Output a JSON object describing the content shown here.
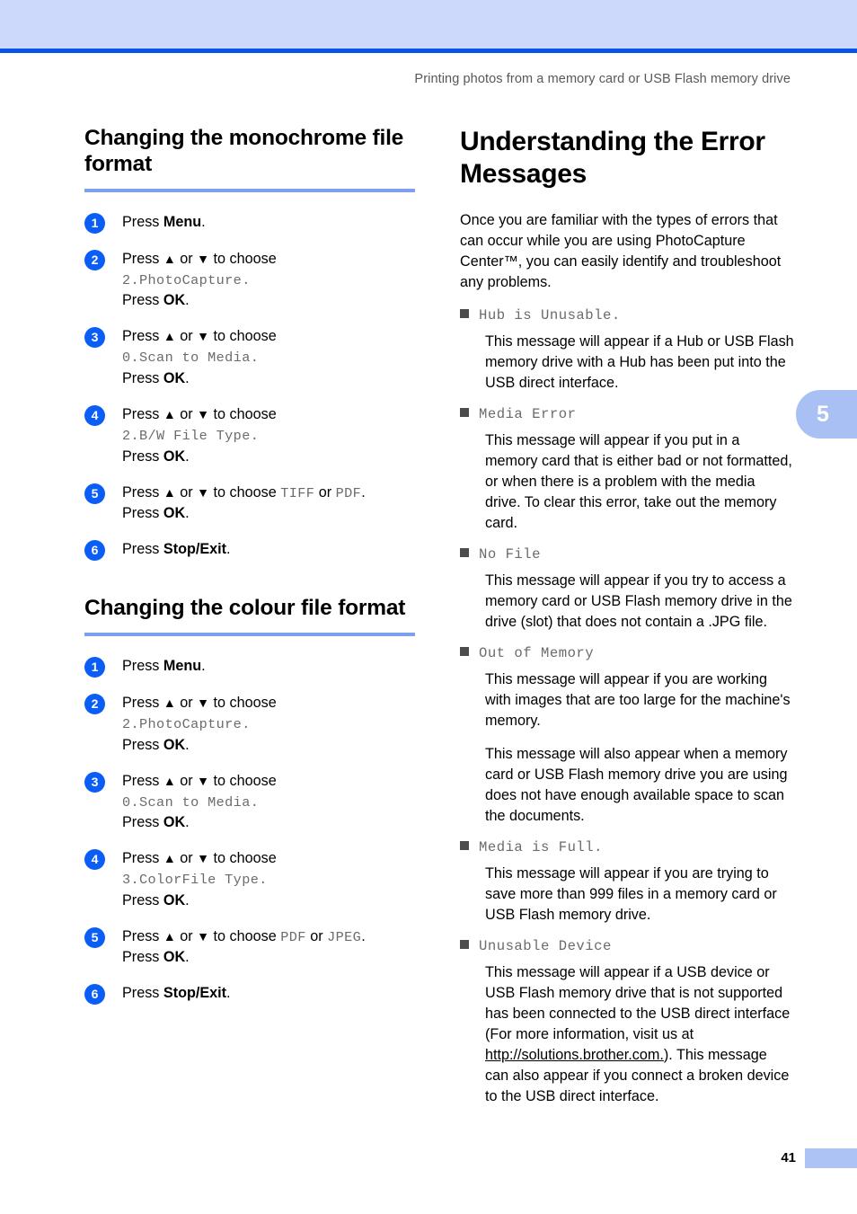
{
  "colors": {
    "band": "#ccd9fa",
    "rule": "#0a52ec",
    "heading_underline": "#7e9ef0",
    "step_circle": "#0b5ef5",
    "tab": "#a9c0f4",
    "bullet": "#4c4c4c",
    "lcd_text": "#6b6b6b"
  },
  "header": {
    "running_title": "Printing photos from a memory card or USB Flash memory drive"
  },
  "chapter_tab": {
    "number": "5"
  },
  "left_column": {
    "sections": [
      {
        "heading": "Changing the monochrome file format",
        "steps": [
          {
            "num": "1",
            "lines": [
              {
                "type": "rich",
                "parts": [
                  {
                    "t": "plain",
                    "v": "Press "
                  },
                  {
                    "t": "bold",
                    "v": "Menu"
                  },
                  {
                    "t": "plain",
                    "v": "."
                  }
                ]
              }
            ]
          },
          {
            "num": "2",
            "lines": [
              {
                "type": "rich",
                "parts": [
                  {
                    "t": "plain",
                    "v": "Press "
                  },
                  {
                    "t": "arrow",
                    "v": "▲"
                  },
                  {
                    "t": "plain",
                    "v": " or "
                  },
                  {
                    "t": "arrow",
                    "v": "▼"
                  },
                  {
                    "t": "plain",
                    "v": " to choose"
                  }
                ]
              },
              {
                "type": "rich",
                "parts": [
                  {
                    "t": "lcd",
                    "v": "2.PhotoCapture"
                  },
                  {
                    "t": "lcd",
                    "v": "."
                  }
                ]
              },
              {
                "type": "rich",
                "parts": [
                  {
                    "t": "plain",
                    "v": "Press "
                  },
                  {
                    "t": "bold",
                    "v": "OK"
                  },
                  {
                    "t": "plain",
                    "v": "."
                  }
                ]
              }
            ]
          },
          {
            "num": "3",
            "lines": [
              {
                "type": "rich",
                "parts": [
                  {
                    "t": "plain",
                    "v": "Press "
                  },
                  {
                    "t": "arrow",
                    "v": "▲"
                  },
                  {
                    "t": "plain",
                    "v": " or "
                  },
                  {
                    "t": "arrow",
                    "v": "▼"
                  },
                  {
                    "t": "plain",
                    "v": " to choose"
                  }
                ]
              },
              {
                "type": "rich",
                "parts": [
                  {
                    "t": "lcd",
                    "v": "0.Scan to Media"
                  },
                  {
                    "t": "lcd",
                    "v": "."
                  }
                ]
              },
              {
                "type": "rich",
                "parts": [
                  {
                    "t": "plain",
                    "v": "Press "
                  },
                  {
                    "t": "bold",
                    "v": "OK"
                  },
                  {
                    "t": "plain",
                    "v": "."
                  }
                ]
              }
            ]
          },
          {
            "num": "4",
            "lines": [
              {
                "type": "rich",
                "parts": [
                  {
                    "t": "plain",
                    "v": "Press "
                  },
                  {
                    "t": "arrow",
                    "v": "▲"
                  },
                  {
                    "t": "plain",
                    "v": " or "
                  },
                  {
                    "t": "arrow",
                    "v": "▼"
                  },
                  {
                    "t": "plain",
                    "v": " to choose"
                  }
                ]
              },
              {
                "type": "rich",
                "parts": [
                  {
                    "t": "lcd",
                    "v": "2.B/W File Type"
                  },
                  {
                    "t": "lcd",
                    "v": "."
                  }
                ]
              },
              {
                "type": "rich",
                "parts": [
                  {
                    "t": "plain",
                    "v": "Press "
                  },
                  {
                    "t": "bold",
                    "v": "OK"
                  },
                  {
                    "t": "plain",
                    "v": "."
                  }
                ]
              }
            ]
          },
          {
            "num": "5",
            "lines": [
              {
                "type": "rich",
                "parts": [
                  {
                    "t": "plain",
                    "v": "Press "
                  },
                  {
                    "t": "arrow",
                    "v": "▲"
                  },
                  {
                    "t": "plain",
                    "v": " or "
                  },
                  {
                    "t": "arrow",
                    "v": "▼"
                  },
                  {
                    "t": "plain",
                    "v": " to choose "
                  },
                  {
                    "t": "lcd",
                    "v": "TIFF"
                  },
                  {
                    "t": "plain",
                    "v": " or "
                  },
                  {
                    "t": "lcd",
                    "v": "PDF"
                  },
                  {
                    "t": "plain",
                    "v": "."
                  }
                ]
              },
              {
                "type": "rich",
                "parts": [
                  {
                    "t": "plain",
                    "v": "Press "
                  },
                  {
                    "t": "bold",
                    "v": "OK"
                  },
                  {
                    "t": "plain",
                    "v": "."
                  }
                ]
              }
            ]
          },
          {
            "num": "6",
            "lines": [
              {
                "type": "rich",
                "parts": [
                  {
                    "t": "plain",
                    "v": "Press "
                  },
                  {
                    "t": "bold",
                    "v": "Stop/Exit"
                  },
                  {
                    "t": "plain",
                    "v": "."
                  }
                ]
              }
            ]
          }
        ]
      },
      {
        "heading": "Changing the colour file format",
        "steps": [
          {
            "num": "1",
            "lines": [
              {
                "type": "rich",
                "parts": [
                  {
                    "t": "plain",
                    "v": "Press "
                  },
                  {
                    "t": "bold",
                    "v": "Menu"
                  },
                  {
                    "t": "plain",
                    "v": "."
                  }
                ]
              }
            ]
          },
          {
            "num": "2",
            "lines": [
              {
                "type": "rich",
                "parts": [
                  {
                    "t": "plain",
                    "v": "Press "
                  },
                  {
                    "t": "arrow",
                    "v": "▲"
                  },
                  {
                    "t": "plain",
                    "v": " or "
                  },
                  {
                    "t": "arrow",
                    "v": "▼"
                  },
                  {
                    "t": "plain",
                    "v": " to choose"
                  }
                ]
              },
              {
                "type": "rich",
                "parts": [
                  {
                    "t": "lcd",
                    "v": "2.PhotoCapture"
                  },
                  {
                    "t": "lcd",
                    "v": "."
                  }
                ]
              },
              {
                "type": "rich",
                "parts": [
                  {
                    "t": "plain",
                    "v": "Press "
                  },
                  {
                    "t": "bold",
                    "v": "OK"
                  },
                  {
                    "t": "plain",
                    "v": "."
                  }
                ]
              }
            ]
          },
          {
            "num": "3",
            "lines": [
              {
                "type": "rich",
                "parts": [
                  {
                    "t": "plain",
                    "v": "Press "
                  },
                  {
                    "t": "arrow",
                    "v": "▲"
                  },
                  {
                    "t": "plain",
                    "v": " or "
                  },
                  {
                    "t": "arrow",
                    "v": "▼"
                  },
                  {
                    "t": "plain",
                    "v": " to choose"
                  }
                ]
              },
              {
                "type": "rich",
                "parts": [
                  {
                    "t": "lcd",
                    "v": "0.Scan to Media"
                  },
                  {
                    "t": "lcd",
                    "v": "."
                  }
                ]
              },
              {
                "type": "rich",
                "parts": [
                  {
                    "t": "plain",
                    "v": "Press "
                  },
                  {
                    "t": "bold",
                    "v": "OK"
                  },
                  {
                    "t": "plain",
                    "v": "."
                  }
                ]
              }
            ]
          },
          {
            "num": "4",
            "lines": [
              {
                "type": "rich",
                "parts": [
                  {
                    "t": "plain",
                    "v": "Press "
                  },
                  {
                    "t": "arrow",
                    "v": "▲"
                  },
                  {
                    "t": "plain",
                    "v": " or "
                  },
                  {
                    "t": "arrow",
                    "v": "▼"
                  },
                  {
                    "t": "plain",
                    "v": " to choose"
                  }
                ]
              },
              {
                "type": "rich",
                "parts": [
                  {
                    "t": "lcd",
                    "v": "3.ColorFile Type"
                  },
                  {
                    "t": "lcd",
                    "v": "."
                  }
                ]
              },
              {
                "type": "rich",
                "parts": [
                  {
                    "t": "plain",
                    "v": "Press "
                  },
                  {
                    "t": "bold",
                    "v": "OK"
                  },
                  {
                    "t": "plain",
                    "v": "."
                  }
                ]
              }
            ]
          },
          {
            "num": "5",
            "lines": [
              {
                "type": "rich",
                "parts": [
                  {
                    "t": "plain",
                    "v": "Press "
                  },
                  {
                    "t": "arrow",
                    "v": "▲"
                  },
                  {
                    "t": "plain",
                    "v": " or "
                  },
                  {
                    "t": "arrow",
                    "v": "▼"
                  },
                  {
                    "t": "plain",
                    "v": " to choose "
                  },
                  {
                    "t": "lcd",
                    "v": "PDF"
                  },
                  {
                    "t": "plain",
                    "v": " or "
                  },
                  {
                    "t": "lcd",
                    "v": "JPEG"
                  },
                  {
                    "t": "plain",
                    "v": "."
                  }
                ]
              },
              {
                "type": "rich",
                "parts": [
                  {
                    "t": "plain",
                    "v": "Press "
                  },
                  {
                    "t": "bold",
                    "v": "OK"
                  },
                  {
                    "t": "plain",
                    "v": "."
                  }
                ]
              }
            ]
          },
          {
            "num": "6",
            "lines": [
              {
                "type": "rich",
                "parts": [
                  {
                    "t": "plain",
                    "v": "Press "
                  },
                  {
                    "t": "bold",
                    "v": "Stop/Exit"
                  },
                  {
                    "t": "plain",
                    "v": "."
                  }
                ]
              }
            ]
          }
        ]
      }
    ]
  },
  "right_column": {
    "heading": "Understanding the Error Messages",
    "intro": "Once you are familiar with the types of errors that can occur while you are using PhotoCapture Center™, you can easily identify and troubleshoot any problems.",
    "errors": [
      {
        "name": "Hub is Unusable.",
        "paragraphs": [
          {
            "type": "plain",
            "text": "This message will appear if a Hub or USB Flash memory drive with a Hub has been put into the USB direct interface."
          }
        ]
      },
      {
        "name": "Media Error",
        "paragraphs": [
          {
            "type": "plain",
            "text": "This message will appear if you put in a memory card that is either bad or not formatted, or when there is a problem with the media drive. To clear this error, take out the memory card."
          }
        ]
      },
      {
        "name": "No File",
        "paragraphs": [
          {
            "type": "plain",
            "text": "This message will appear if you try to access a memory card or USB Flash memory drive in the drive (slot) that does not contain a .JPG file."
          }
        ]
      },
      {
        "name": "Out of Memory",
        "paragraphs": [
          {
            "type": "plain",
            "text": "This message will appear if you are working with images that are too large for the machine's memory."
          },
          {
            "type": "plain",
            "text": "This message will also appear when a memory card or USB Flash memory drive you are using does not have enough available space to scan the documents."
          }
        ]
      },
      {
        "name": "Media is Full.",
        "paragraphs": [
          {
            "type": "plain",
            "text": "This message will appear if you are trying to save more than 999 files in a memory card or USB Flash memory drive."
          }
        ]
      },
      {
        "name": "Unusable Device",
        "paragraphs": [
          {
            "type": "link",
            "before": "This message will appear if a USB device or USB Flash memory drive that is not supported has been connected to the USB direct interface (For more information, visit us at ",
            "link": "http://solutions.brother.com.",
            "after": "). This message can also appear if you connect a broken device to the USB direct interface."
          }
        ]
      }
    ]
  },
  "footer": {
    "page_number": "41"
  }
}
